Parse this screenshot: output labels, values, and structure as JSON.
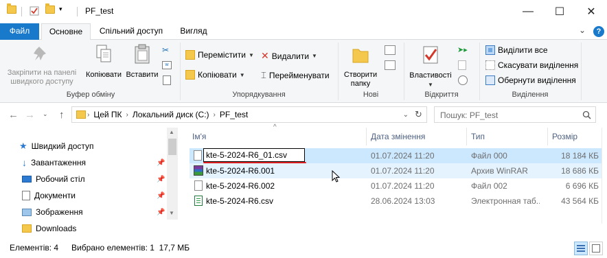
{
  "window": {
    "title": "PF_test",
    "minimize": "—",
    "maximize": "☐",
    "close": "✕"
  },
  "ribbon_tabs": [
    "Файл",
    "Основне",
    "Спільний доступ",
    "Вигляд"
  ],
  "ribbon": {
    "clipboard": {
      "pin_label": "Закріпити на панелі швидкого доступу",
      "copy_label": "Копіювати",
      "paste_label": "Вставити",
      "group_label": "Буфер обміну"
    },
    "organize": {
      "move_label": "Перемістити",
      "copy_to_label": "Копіювати",
      "delete_label": "Видалити",
      "rename_label": "Перейменувати",
      "group_label": "Упорядкування"
    },
    "new": {
      "new_folder_label": "Створити папку",
      "group_label": "Нові"
    },
    "open": {
      "properties_label": "Властивості",
      "group_label": "Відкриття"
    },
    "select": {
      "select_all_label": "Виділити все",
      "select_none_label": "Скасувати виділення",
      "invert_label": "Обернути виділення",
      "group_label": "Виділення"
    }
  },
  "address": {
    "crumbs": [
      "Цей ПК",
      "Локальний диск (C:)",
      "PF_test"
    ],
    "search_placeholder": "Пошук: PF_test"
  },
  "nav_pane": {
    "quick_access": "Швидкий доступ",
    "items": [
      "Завантаження",
      "Робочий стіл",
      "Документи",
      "Зображення",
      "Downloads"
    ]
  },
  "file_list": {
    "columns": [
      "Ім'я",
      "Дата змінення",
      "Тип",
      "Розмір"
    ],
    "rows": [
      {
        "name": "kte-5-2024-R6_01.csv",
        "date": "01.07.2024 11:20",
        "type": "Файл 000",
        "size": "18 184 КБ",
        "icon": "blank-file-icon"
      },
      {
        "name": "kte-5-2024-R6.001",
        "date": "01.07.2024 11:20",
        "type": "Архив WinRAR",
        "size": "18 686 КБ",
        "icon": "winrar-archive-icon"
      },
      {
        "name": "kte-5-2024-R6.002",
        "date": "01.07.2024 11:20",
        "type": "Файл 002",
        "size": "6 696 КБ",
        "icon": "blank-file-icon"
      },
      {
        "name": "kte-5-2024-R6.csv",
        "date": "28.06.2024 13:03",
        "type": "Электронная таб...",
        "size": "43 564 КБ",
        "icon": "spreadsheet-icon"
      }
    ]
  },
  "status": {
    "count": "Елементів: 4",
    "selection": "Вибрано елементів: 1  17,7 МБ"
  },
  "colors": {
    "accent": "#1979ca",
    "selection": "#cce8ff",
    "rename_underline": "#e02020"
  }
}
